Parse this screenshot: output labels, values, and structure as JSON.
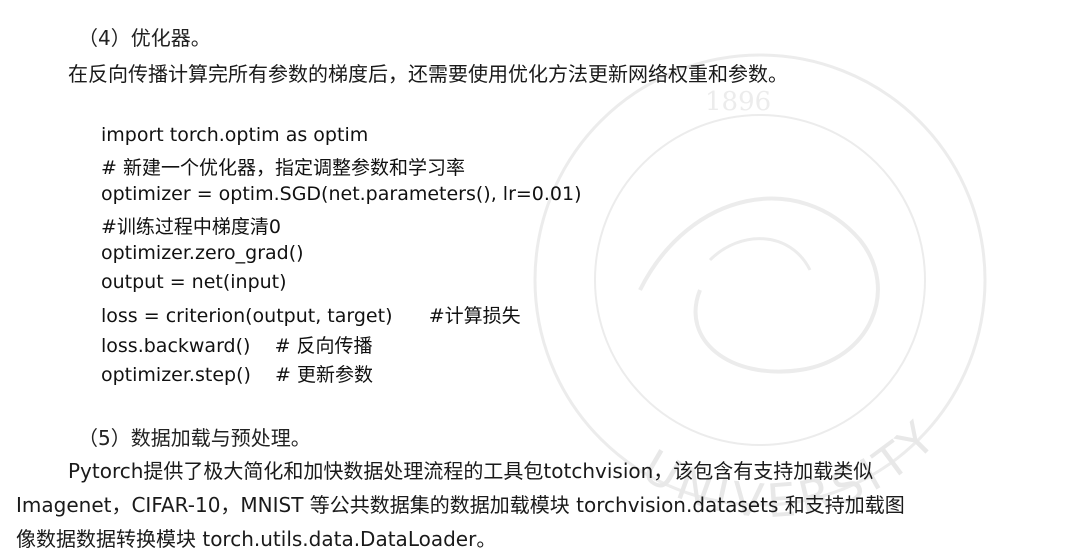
{
  "top_fragment": "y",
  "section4": {
    "heading": "（4）优化器。",
    "paragraph": "在反向传播计算完所有参数的梯度后，还需要使用优化方法更新网络权重和参数。"
  },
  "code": [
    "import torch.optim as optim",
    "# 新建一个优化器，指定调整参数和学习率",
    "optimizer = optim.SGD(net.parameters(), lr=0.01)",
    "#训练过程中梯度清0",
    "optimizer.zero_grad()",
    "output = net(input)",
    "loss = criterion(output, target)      #计算损失",
    "loss.backward()    # 反向传播",
    "optimizer.step()    # 更新参数"
  ],
  "section5": {
    "heading": "（5）数据加载与预处理。",
    "lines": [
      "Pytorch提供了极大简化和加快数据处理流程的工具包totchvision，该包含有支持加载类似",
      "Imagenet，CIFAR-10，MNIST 等公共数据集的数据加载模块 torchvision.datasets 和支持加载图",
      "像数据数据转换模块 torch.utils.data.DataLoader。"
    ]
  },
  "watermark": {
    "text": "UNIVERSITY",
    "year": "1896",
    "color": "#ececec"
  }
}
